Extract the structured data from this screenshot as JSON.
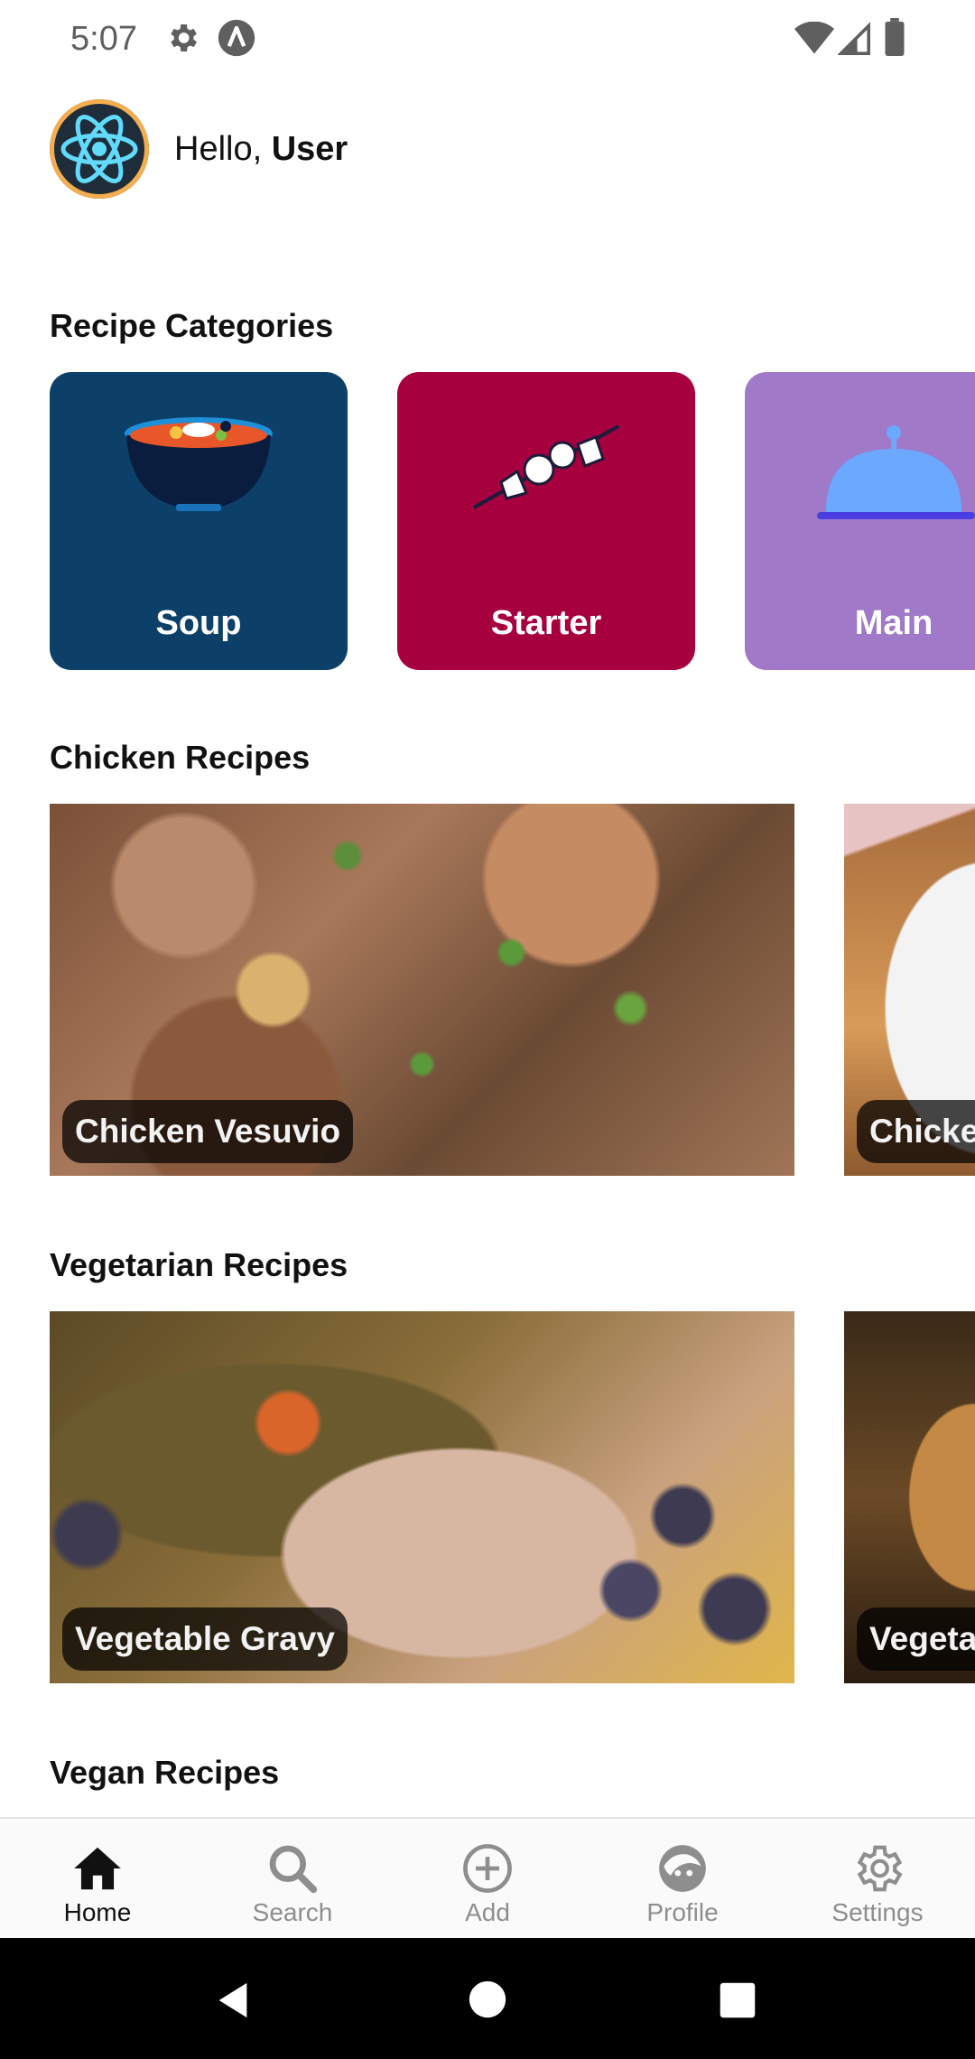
{
  "status": {
    "time": "5:07"
  },
  "header": {
    "greeting": "Hello, ",
    "username": "User"
  },
  "sections": {
    "categories_title": "Recipe Categories",
    "chicken_title": "Chicken Recipes",
    "vegetarian_title": "Vegetarian Recipes",
    "vegan_title": "Vegan Recipes"
  },
  "categories": [
    {
      "label": "Soup",
      "color": "#0c4069"
    },
    {
      "label": "Starter",
      "color": "#a6003f"
    },
    {
      "label": "Main",
      "color": "#a07ac8"
    }
  ],
  "chicken": [
    {
      "label": "Chicken Vesuvio"
    },
    {
      "label": "Chicke"
    }
  ],
  "vegetarian": [
    {
      "label": "Vegetable Gravy"
    },
    {
      "label": "Vegeta"
    }
  ],
  "nav": {
    "home": "Home",
    "search": "Search",
    "add": "Add",
    "profile": "Profile",
    "settings": "Settings"
  }
}
